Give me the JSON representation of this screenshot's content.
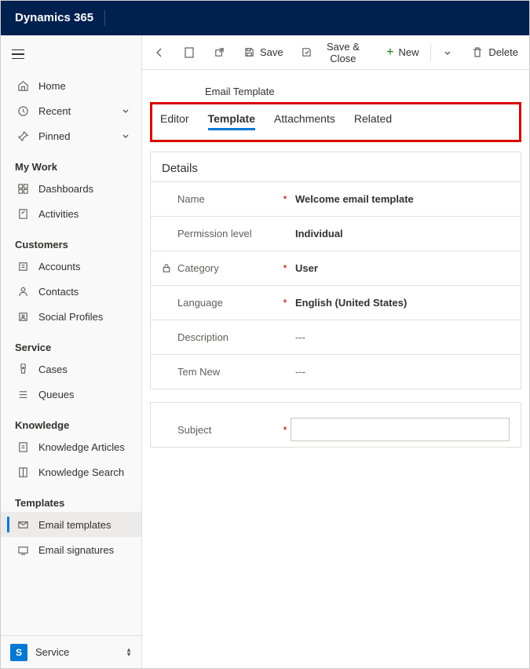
{
  "header": {
    "title": "Dynamics 365"
  },
  "sidebar": {
    "home": "Home",
    "recent": "Recent",
    "pinned": "Pinned",
    "sections": {
      "mywork": {
        "title": "My Work",
        "items": [
          {
            "label": "Dashboards",
            "icon": "dashboard-icon"
          },
          {
            "label": "Activities",
            "icon": "activities-icon"
          }
        ]
      },
      "customers": {
        "title": "Customers",
        "items": [
          {
            "label": "Accounts",
            "icon": "accounts-icon"
          },
          {
            "label": "Contacts",
            "icon": "contacts-icon"
          },
          {
            "label": "Social Profiles",
            "icon": "social-icon"
          }
        ]
      },
      "service": {
        "title": "Service",
        "items": [
          {
            "label": "Cases",
            "icon": "cases-icon"
          },
          {
            "label": "Queues",
            "icon": "queues-icon"
          }
        ]
      },
      "knowledge": {
        "title": "Knowledge",
        "items": [
          {
            "label": "Knowledge Articles",
            "icon": "ka-icon"
          },
          {
            "label": "Knowledge Search",
            "icon": "ks-icon"
          }
        ]
      },
      "templates": {
        "title": "Templates",
        "items": [
          {
            "label": "Email templates",
            "icon": "email-tpl-icon",
            "active": true
          },
          {
            "label": "Email signatures",
            "icon": "email-sig-icon"
          }
        ]
      }
    }
  },
  "appPicker": {
    "badge": "S",
    "label": "Service"
  },
  "cmdbar": {
    "save": "Save",
    "saveClose": "Save & Close",
    "newBtn": "New",
    "deleteBtn": "Delete"
  },
  "entity": {
    "type": "Email Template"
  },
  "tabs": {
    "editor": "Editor",
    "template": "Template",
    "attachments": "Attachments",
    "related": "Related"
  },
  "details": {
    "title": "Details",
    "rows": {
      "name": {
        "label": "Name",
        "required": true,
        "value": "Welcome email template"
      },
      "permission": {
        "label": "Permission level",
        "required": false,
        "value": "Individual"
      },
      "category": {
        "label": "Category",
        "required": true,
        "locked": true,
        "value": "User"
      },
      "language": {
        "label": "Language",
        "required": true,
        "value": "English (United States)"
      },
      "description": {
        "label": "Description",
        "required": false,
        "value": "---"
      },
      "temnew": {
        "label": "Tem New",
        "required": false,
        "value": "---"
      }
    }
  },
  "subject": {
    "label": "Subject",
    "required": true,
    "value": ""
  }
}
